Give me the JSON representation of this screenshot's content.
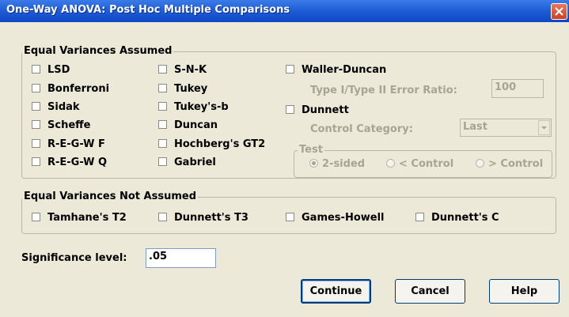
{
  "window": {
    "title": "One-Way ANOVA: Post Hoc Multiple Comparisons"
  },
  "equal_variances_assumed": {
    "legend": "Equal Variances Assumed",
    "col1": [
      "LSD",
      "Bonferroni",
      "Sidak",
      "Scheffe",
      "R-E-G-W F",
      "R-E-G-W Q"
    ],
    "col2": [
      "S-N-K",
      "Tukey",
      "Tukey's-b",
      "Duncan",
      "Hochberg's GT2",
      "Gabriel"
    ],
    "waller_duncan": "Waller-Duncan",
    "error_ratio_label": "Type I/Type II Error Ratio:",
    "error_ratio_value": "100",
    "dunnett": "Dunnett",
    "control_category_label": "Control Category:",
    "control_category_value": "Last",
    "test": {
      "legend": "Test",
      "options": [
        "2-sided",
        "< Control",
        "> Control"
      ],
      "selected": "2-sided"
    }
  },
  "equal_variances_not_assumed": {
    "legend": "Equal Variances Not Assumed",
    "options": [
      "Tamhane's T2",
      "Dunnett's T3",
      "Games-Howell",
      "Dunnett's C"
    ]
  },
  "significance": {
    "label": "Significance level:",
    "value": ".05"
  },
  "buttons": {
    "continue": "Continue",
    "cancel": "Cancel",
    "help": "Help"
  }
}
